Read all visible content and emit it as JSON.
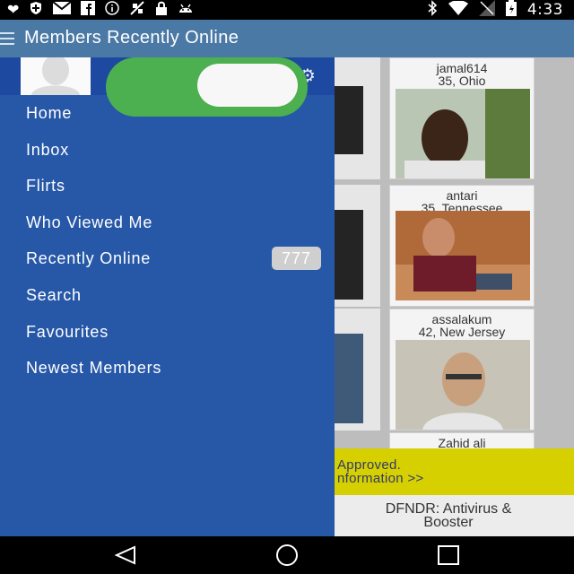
{
  "status_bar": {
    "time": "4:33",
    "left_icons": [
      "heart-icon",
      "shield-icon",
      "mail-icon",
      "facebook-icon",
      "info-icon",
      "satellite-icon",
      "lock-icon",
      "android-icon"
    ],
    "right_icons": [
      "bluetooth-icon",
      "wifi-icon",
      "no-signal-icon",
      "battery-icon"
    ]
  },
  "app_bar": {
    "title": "Members Recently Online",
    "icon": "hamburger-icon"
  },
  "drawer": {
    "items": [
      {
        "label": "Home"
      },
      {
        "label": "Inbox"
      },
      {
        "label": "Flirts"
      },
      {
        "label": "Who Viewed Me"
      },
      {
        "label": "Recently Online",
        "badge": "777"
      },
      {
        "label": "Search"
      },
      {
        "label": "Favourites"
      },
      {
        "label": "Newest Members"
      }
    ],
    "settings_icon": "gear-icon"
  },
  "members": [
    {
      "name": "jamal614",
      "location": "35, Ohio"
    },
    {
      "name": "antari",
      "location": "35, Tennessee"
    },
    {
      "name": "assalakum",
      "location": "42, New Jersey"
    },
    {
      "name": "Zahid ali",
      "location": ""
    }
  ],
  "banner": {
    "line1": "Approved.",
    "line2": "nformation >>"
  },
  "ad": {
    "line1": "DFNDR: Antivirus &",
    "line2": "Booster"
  },
  "colors": {
    "app_bar": "#4b79a6",
    "drawer": "#2758a8",
    "toggle_on": "#4caf50",
    "banner": "#d6d000"
  }
}
